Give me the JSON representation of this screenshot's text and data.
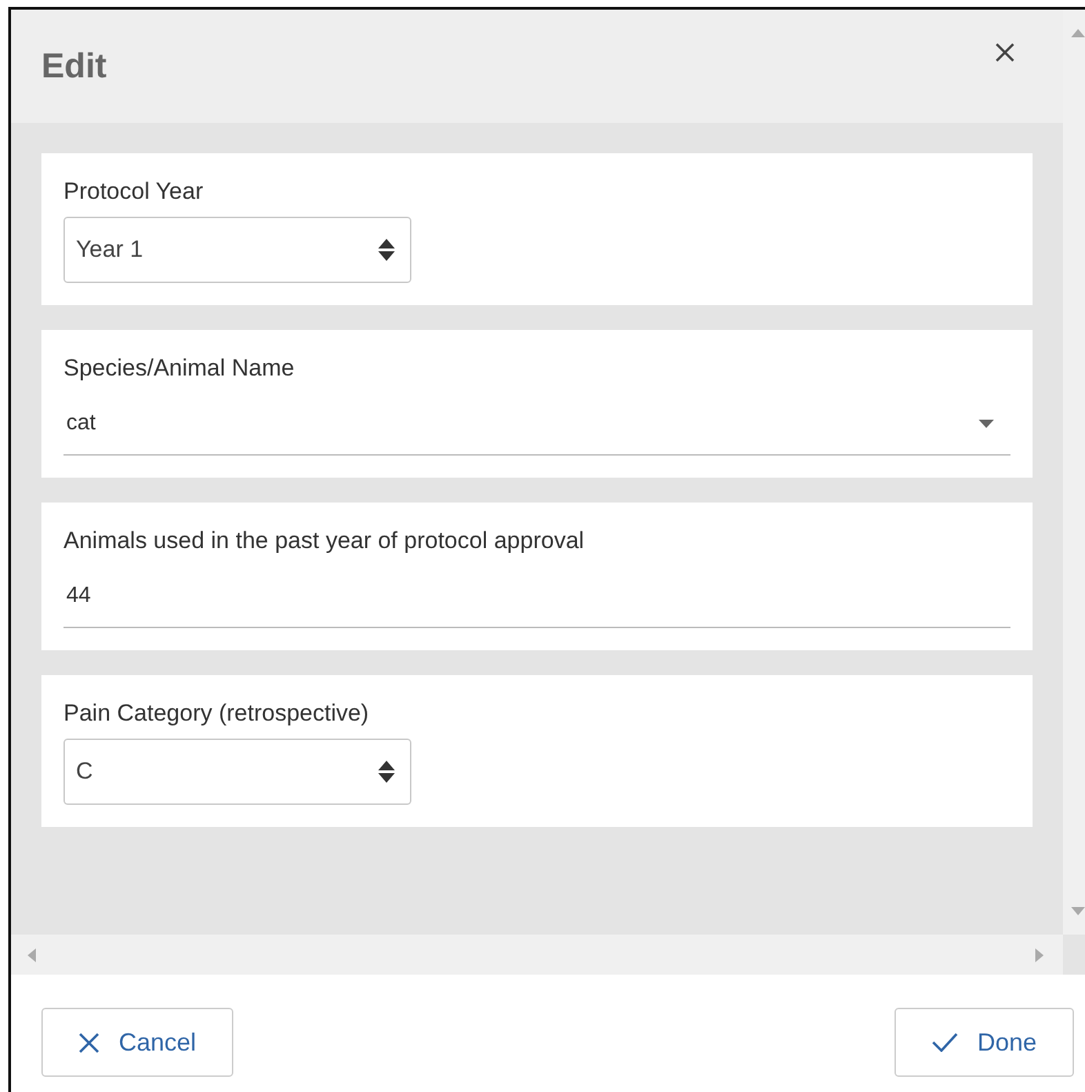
{
  "dialog": {
    "title": "Edit"
  },
  "fields": [
    {
      "kind": "select",
      "label": "Protocol Year",
      "value": "Year 1"
    },
    {
      "kind": "dropdown",
      "label": "Species/Animal Name",
      "value": "cat"
    },
    {
      "kind": "text",
      "label": "Animals used in the past year of protocol approval",
      "value": "44"
    },
    {
      "kind": "select",
      "label": "Pain Category (retrospective)",
      "value": "C"
    }
  ],
  "buttons": [
    {
      "kind": "cancel",
      "label": "Cancel"
    },
    {
      "kind": "done",
      "label": "Done"
    }
  ]
}
